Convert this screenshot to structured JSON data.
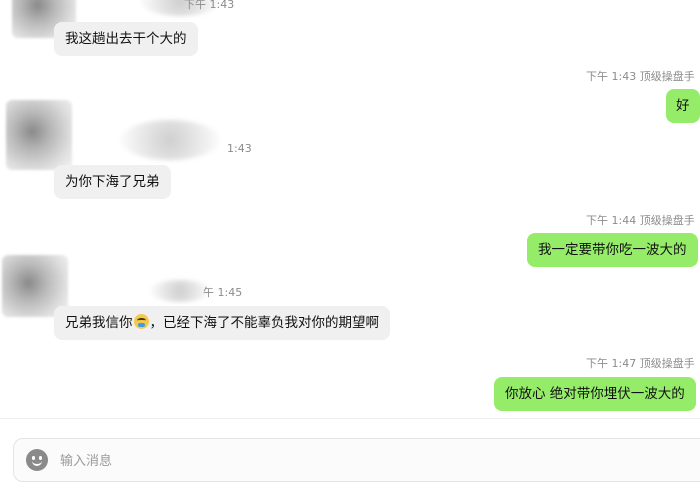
{
  "messages": [
    {
      "side": "in",
      "meta": "下午 1:43",
      "text": "我这趟出去干个大的"
    },
    {
      "side": "out",
      "meta": "下午 1:43 顶级操盘手",
      "text": "好"
    },
    {
      "side": "in",
      "meta": "1:43",
      "text": "为你下海了兄弟"
    },
    {
      "side": "out",
      "meta": "下午 1:44 顶级操盘手",
      "text": "我一定要带你吃一波大的"
    },
    {
      "side": "in",
      "meta": "午 1:45",
      "text_before": "兄弟我信你",
      "emoji": "crying-face-emoji",
      "text_after": "，已经下海了不能辜负我对你的期望啊"
    },
    {
      "side": "out",
      "meta": "下午 1:47 顶级操盘手",
      "text": "你放心 绝对带你埋伏一波大的"
    }
  ],
  "composer": {
    "placeholder": "输入消息",
    "emoji_icon": "smiley-face-icon"
  }
}
